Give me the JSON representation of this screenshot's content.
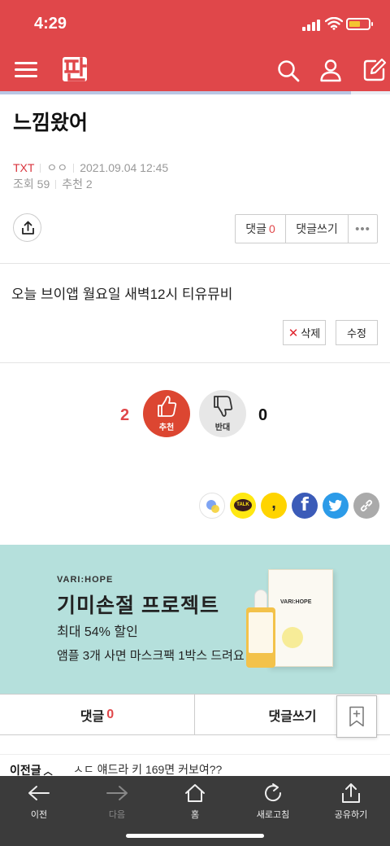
{
  "status": {
    "time": "4:29"
  },
  "header": {
    "logo_text": "판"
  },
  "post": {
    "title": "느낌왔어",
    "category": "TXT",
    "author": "ㅇㅇ",
    "date": "2021.09.04 12:45",
    "views_label": "조회",
    "views": "59",
    "recommend_label": "추천",
    "recommend_count": "2",
    "body": "오늘 브이앱 월요일 새벽12시 티유뮤비"
  },
  "actions": {
    "comment_label": "댓글",
    "comment_count": "0",
    "write_comment_label": "댓글쓰기",
    "more_label": "•••",
    "delete_label": "삭제",
    "edit_label": "수정"
  },
  "vote": {
    "recommend_count": "2",
    "recommend_label": "추천",
    "oppose_label": "반대",
    "oppose_count": "0"
  },
  "social": {
    "kakaotalk_label": "TALK",
    "kakaostory_label": ",",
    "facebook_label": "f"
  },
  "ad": {
    "brand": "VARI:HOPE",
    "headline": "기미손절 프로젝트",
    "discount": "최대 54% 할인",
    "promo": "앰플 3개 사면 마스크팩 1박스 드려요",
    "product_brand": "VARI:HOPE"
  },
  "comment_bar": {
    "comment_label": "댓글",
    "comment_count": "0",
    "write_label": "댓글쓰기"
  },
  "prev_post": {
    "label": "이전글",
    "chevron": "︿",
    "title": "ㅅㄷ 얘드라 키 169면 커보여??"
  },
  "bottom_nav": {
    "items": [
      {
        "label": "이전"
      },
      {
        "label": "다음"
      },
      {
        "label": "홈"
      },
      {
        "label": "새로고침"
      },
      {
        "label": "공유하기"
      }
    ]
  },
  "colors": {
    "brand_red": "#e0474a",
    "ad_bg": "#b5e0dc",
    "recommend_btn": "#dc4631",
    "bottom_bar": "#3b3b3b"
  }
}
